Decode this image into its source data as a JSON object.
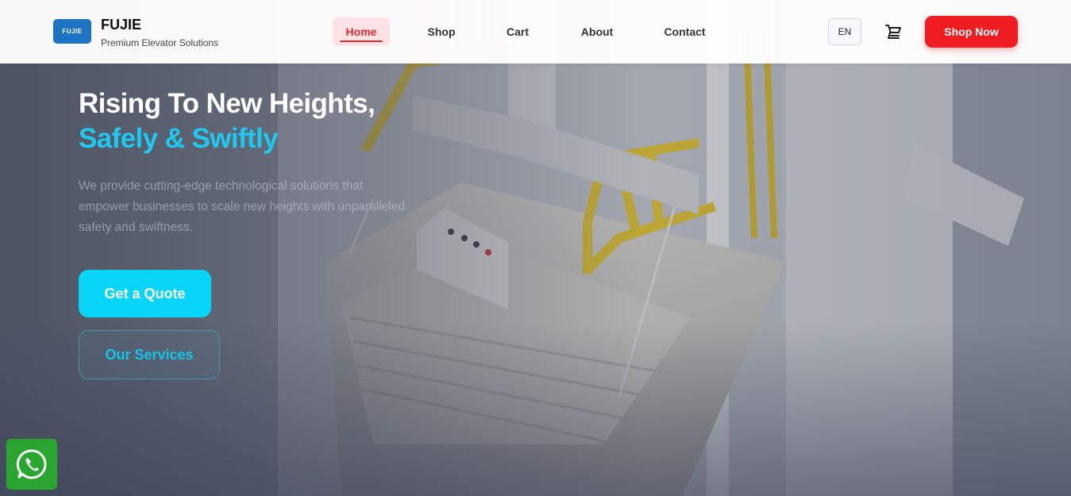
{
  "brand": {
    "logo_text": "FUJIE",
    "name": "FUJIE",
    "tagline": "Premium Elevator Solutions",
    "logo_color": "#1e73c4"
  },
  "nav": {
    "items": [
      {
        "label": "Home",
        "active": true
      },
      {
        "label": "Shop",
        "active": false
      },
      {
        "label": "Cart",
        "active": false
      },
      {
        "label": "About",
        "active": false
      },
      {
        "label": "Contact",
        "active": false
      }
    ],
    "language": "EN",
    "cart_icon": "cart-icon",
    "cta_label": "Shop Now"
  },
  "hero": {
    "title_line1": "Rising To New Heights,",
    "title_line2": "Safely & Swiftly",
    "description": "We provide cutting-edge technological solutions that empower businesses to scale new heights with unparalleled safety and swiftness.",
    "primary_button": "Get a Quote",
    "secondary_button": "Our Services"
  },
  "floating": {
    "whatsapp_icon": "whatsapp-icon"
  },
  "colors": {
    "accent_red": "#ef1c22",
    "accent_cyan": "#07d4f7",
    "headline_cyan": "#1ec8ef",
    "whatsapp_green": "#2aa52f"
  }
}
